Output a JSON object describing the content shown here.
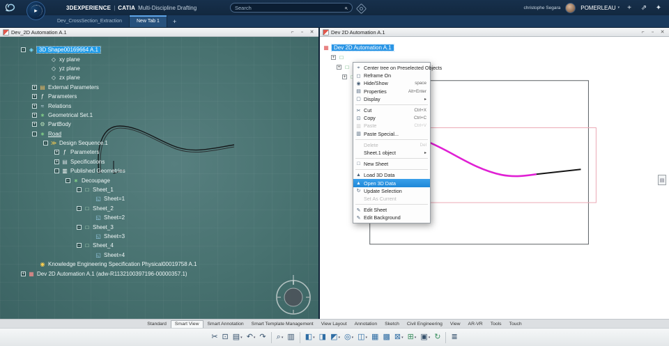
{
  "topbar": {
    "brand": "3DEXPERIENCE",
    "separator": "|",
    "app": "CATIA",
    "app_module": "Multi-Discipline Drafting",
    "search": {
      "placeholder": "Search"
    },
    "user_name": "christophe Segara",
    "tenant": "POMERLEAU"
  },
  "tab_bar": {
    "tabs": [
      {
        "label": "Dev_CrossSection_Extraction",
        "active": false
      },
      {
        "label": "New Tab 1",
        "active": true
      }
    ],
    "new_tab": "+"
  },
  "left_window": {
    "title": "Dev_2D Automation A.1",
    "tree": [
      {
        "label": "3D Shape00169664 A.1",
        "indent": 0,
        "expander": "-",
        "icon": "shape",
        "selected": true
      },
      {
        "label": "xy plane",
        "indent": 2,
        "icon": "plane"
      },
      {
        "label": "yz plane",
        "indent": 2,
        "icon": "plane"
      },
      {
        "label": "zx plane",
        "indent": 2,
        "icon": "plane"
      },
      {
        "label": "External Parameters",
        "indent": 1,
        "expander": "+",
        "icon": "folder"
      },
      {
        "label": "Parameters",
        "indent": 1,
        "expander": "+",
        "icon": "params"
      },
      {
        "label": "Relations",
        "indent": 1,
        "expander": "+",
        "icon": "relations"
      },
      {
        "label": "Geometrical Set.1",
        "indent": 1,
        "expander": "+",
        "icon": "geoset"
      },
      {
        "label": "PartBody",
        "indent": 1,
        "expander": "+",
        "icon": "partbody"
      },
      {
        "label": "Road",
        "indent": 1,
        "expander": "-",
        "icon": "geoset",
        "underline": true
      },
      {
        "label": "Design Sequence.1",
        "indent": 2,
        "expander": "-",
        "icon": "sequence"
      },
      {
        "label": "Parameters",
        "indent": 3,
        "expander": "+",
        "icon": "params"
      },
      {
        "label": "Specifications",
        "indent": 3,
        "expander": "+",
        "icon": "spec"
      },
      {
        "label": "Published Geometries",
        "indent": 3,
        "expander": "-",
        "icon": "published"
      },
      {
        "label": "Decoupage",
        "indent": 4,
        "expander": "-",
        "icon": "geoset"
      },
      {
        "label": "Sheet_1",
        "indent": 5,
        "expander": "-",
        "icon": "sheetset"
      },
      {
        "label": "Sheet=1",
        "indent": 6,
        "icon": "sheetval"
      },
      {
        "label": "Sheet_2",
        "indent": 5,
        "expander": "-",
        "icon": "sheetset"
      },
      {
        "label": "Sheet=2",
        "indent": 6,
        "icon": "sheetval"
      },
      {
        "label": "Sheet_3",
        "indent": 5,
        "expander": "-",
        "icon": "sheetset"
      },
      {
        "label": "Sheet=3",
        "indent": 6,
        "icon": "sheetval"
      },
      {
        "label": "Sheet_4",
        "indent": 5,
        "expander": "-",
        "icon": "sheetset"
      },
      {
        "label": "Sheet=4",
        "indent": 6,
        "icon": "sheetval"
      },
      {
        "label": "Knowledge Engineering Specification Physical00019758 A.1",
        "indent": 1,
        "icon": "knowledge"
      },
      {
        "label": "Dev 2D Automation A.1 (adw-R1132100397196-00000357.1)",
        "indent": 0,
        "expander": "+",
        "icon": "drawing"
      }
    ]
  },
  "right_window": {
    "title": "Dev 2D Automation A.1",
    "root_item": "Dev 2D Automation A.1",
    "context_menu": {
      "items": [
        {
          "label": "Center tree on Preselected Objects",
          "icon": "tree"
        },
        {
          "label": "Reframe On",
          "icon": "reframe"
        },
        {
          "label": "Hide/Show",
          "shortcut": "space",
          "icon": "hide"
        },
        {
          "label": "Properties",
          "shortcut": "Alt+Enter",
          "icon": "properties"
        },
        {
          "label": "Display",
          "submenu": true,
          "icon": "display"
        },
        {
          "separator": true
        },
        {
          "label": "Cut",
          "shortcut": "Ctrl+X",
          "icon": "cut"
        },
        {
          "label": "Copy",
          "shortcut": "Ctrl+C",
          "icon": "copy"
        },
        {
          "label": "Paste",
          "shortcut": "Ctrl+V",
          "icon": "paste",
          "disabled": true
        },
        {
          "label": "Paste Special...",
          "icon": "paste-special"
        },
        {
          "separator": true
        },
        {
          "label": "Delete",
          "shortcut": "Del",
          "disabled": true
        },
        {
          "label": "Sheet.1 object",
          "submenu": true
        },
        {
          "separator": true
        },
        {
          "label": "New Sheet",
          "icon": "sheet"
        },
        {
          "separator": true
        },
        {
          "label": "Load 3D Data",
          "icon": "load"
        },
        {
          "label": "Open 3D Data",
          "icon": "open",
          "selected": true
        },
        {
          "label": "Update Selection",
          "icon": "update"
        },
        {
          "label": "Set As Current",
          "disabled": true
        },
        {
          "separator": true
        },
        {
          "label": "Edit Sheet",
          "icon": "edit"
        },
        {
          "label": "Edit Background",
          "icon": "edit"
        }
      ]
    }
  },
  "ribbon_tabs": [
    {
      "label": "Standard"
    },
    {
      "label": "Smart View",
      "active": true
    },
    {
      "label": "Smart Annotation"
    },
    {
      "label": "Smart Template Management"
    },
    {
      "label": "View Layout"
    },
    {
      "label": "Annotation"
    },
    {
      "label": "Sketch"
    },
    {
      "label": "Civil Engineering"
    },
    {
      "label": "View"
    },
    {
      "label": "AR-VR"
    },
    {
      "label": "Tools"
    },
    {
      "label": "Touch"
    }
  ],
  "toolbar": {
    "items": [
      {
        "glyph": "✂",
        "name": "cut"
      },
      {
        "glyph": "⊡",
        "name": "copy"
      },
      {
        "glyph": "▤",
        "name": "paste",
        "arrow": true
      },
      {
        "glyph": "↶",
        "name": "undo",
        "arrow": true
      },
      {
        "glyph": "↷",
        "name": "redo"
      },
      {
        "sep": true
      },
      {
        "glyph": "⌕",
        "name": "zoom",
        "arrow": true
      },
      {
        "glyph": "▥",
        "name": "catalog-browser"
      },
      {
        "sep": true
      },
      {
        "glyph": "◧",
        "name": "front-view",
        "arrow": true,
        "color": "#2e6da4"
      },
      {
        "glyph": "◨",
        "name": "projection-view",
        "color": "#2e6da4"
      },
      {
        "glyph": "◩",
        "name": "section-view",
        "arrow": true,
        "color": "#2e6da4"
      },
      {
        "glyph": "◎",
        "name": "detail-view",
        "arrow": true,
        "color": "#2e6da4"
      },
      {
        "glyph": "◫",
        "name": "clipping-view",
        "arrow": true,
        "color": "#2e6da4"
      },
      {
        "glyph": "▦",
        "name": "broken-view",
        "color": "#2e6da4"
      },
      {
        "glyph": "▩",
        "name": "breakout-view",
        "color": "#2e6da4"
      },
      {
        "glyph": "⊠",
        "name": "isometric-view",
        "arrow": true,
        "color": "#2e6da4"
      },
      {
        "glyph": "⊞",
        "name": "new-sheet",
        "arrow": true,
        "color": "#3a8f5f"
      },
      {
        "glyph": "▣",
        "name": "instantiate-2d-component",
        "arrow": true
      },
      {
        "glyph": "↻",
        "name": "update",
        "color": "#3a8f5f"
      },
      {
        "sep": true
      },
      {
        "glyph": "≣",
        "name": "frame-title-block"
      }
    ]
  },
  "colors": {
    "accent_selection": "#1f9be8",
    "menu_selection": "#2a95e5",
    "left_canvas": "#47716f",
    "curve_magenta": "#e020d4",
    "topbar": "#142c46"
  }
}
